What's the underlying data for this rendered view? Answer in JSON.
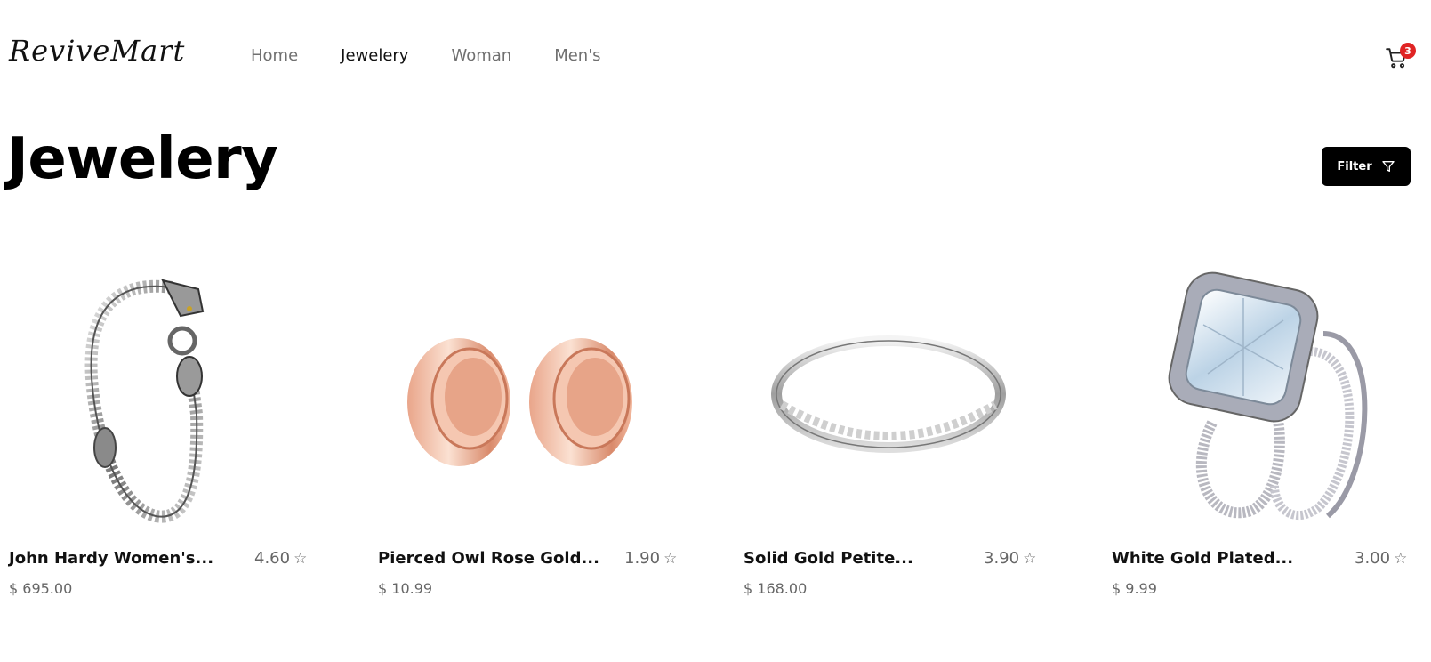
{
  "brand": {
    "logo": "ReviveMart"
  },
  "nav": {
    "items": [
      {
        "label": "Home",
        "active": false
      },
      {
        "label": "Jewelery",
        "active": true
      },
      {
        "label": "Woman",
        "active": false
      },
      {
        "label": "Men's",
        "active": false
      }
    ]
  },
  "cart": {
    "count": "3",
    "icon": "cart-icon",
    "badge_color": "#e02424"
  },
  "page": {
    "title": "Jewelery"
  },
  "filter": {
    "label": "Filter",
    "icon": "filter-icon"
  },
  "products": [
    {
      "name": "John Hardy Women's...",
      "rating": "4.60",
      "price": "$ 695.00",
      "image": "silver-dragon-bracelet"
    },
    {
      "name": "Pierced Owl Rose Gold...",
      "rating": "1.90",
      "price": "$ 10.99",
      "image": "rose-gold-tunnel-plugs"
    },
    {
      "name": "Solid Gold Petite...",
      "rating": "3.90",
      "price": "$ 168.00",
      "image": "micropave-band-ring"
    },
    {
      "name": "White Gold Plated...",
      "rating": "3.00",
      "price": "$ 9.99",
      "image": "bridal-ring-set"
    }
  ]
}
